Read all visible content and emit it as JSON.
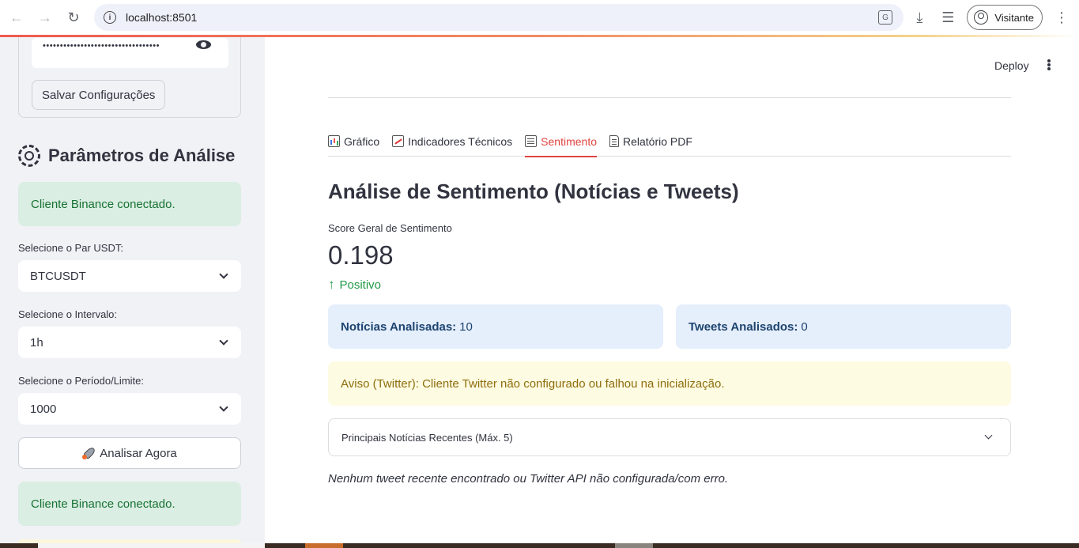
{
  "browser": {
    "url": "localhost:8501",
    "profile_label": "Visitante"
  },
  "sidebar": {
    "password_mask": "••••••••••••••••••••••••••••••••••",
    "save_button": "Salvar Configurações",
    "params_title": "Parâmetros de Análise",
    "binance_alert_1": "Cliente Binance conectado.",
    "pair_label": "Selecione o Par USDT:",
    "pair_value": "BTCUSDT",
    "interval_label": "Selecione o Intervalo:",
    "interval_value": "1h",
    "period_label": "Selecione o Período/Limite:",
    "period_value": "1000",
    "analyze_button": "Analisar Agora",
    "binance_alert_2": "Cliente Binance conectado."
  },
  "header": {
    "deploy_label": "Deploy"
  },
  "tabs": [
    {
      "label": "Gráfico",
      "icon": "bar-chart-icon",
      "active": false
    },
    {
      "label": "Indicadores Técnicos",
      "icon": "chart-increasing-icon",
      "active": false
    },
    {
      "label": "Sentimento",
      "icon": "newspaper-icon",
      "active": true
    },
    {
      "label": "Relatório PDF",
      "icon": "document-icon",
      "active": false
    }
  ],
  "main": {
    "title": "Análise de Sentimento (Notícias e Tweets)",
    "metric": {
      "label": "Score Geral de Sentimento",
      "value": "0.198",
      "delta": "Positivo",
      "delta_color": "#1f9a47"
    },
    "news_box": {
      "label": "Notícias Analisadas:",
      "value": "10"
    },
    "tweets_box": {
      "label": "Tweets Analisados:",
      "value": "0"
    },
    "warning": "Aviso (Twitter): Cliente Twitter não configurado ou falhou na inicialização.",
    "expander_label": "Principais Notícias Recentes (Máx. 5)",
    "caption": "Nenhum tweet recente encontrado ou Twitter API não configurada/com erro."
  },
  "colors": {
    "accent": "#e0453f",
    "success_bg": "#dbeee3",
    "info_bg": "#e5eefb",
    "warning_bg": "#fdfbe1"
  }
}
